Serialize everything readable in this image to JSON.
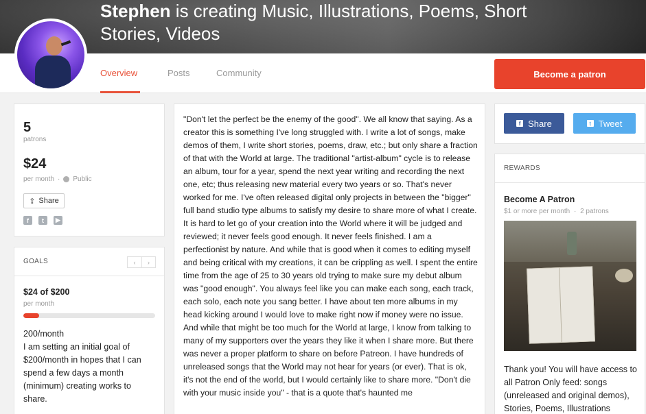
{
  "banner": {
    "creator_name": "Stephen",
    "creating_text": " is creating Music, Illustrations, Poems, Short Stories, Videos"
  },
  "nav": {
    "tabs": [
      {
        "label": "Overview",
        "active": true
      },
      {
        "label": "Posts",
        "active": false
      },
      {
        "label": "Community",
        "active": false
      }
    ],
    "become_patron_label": "Become a patron"
  },
  "stats": {
    "patrons_count": "5",
    "patrons_label": "patrons",
    "amount": "$24",
    "amount_period": "per month",
    "separator": "·",
    "visibility": "Public",
    "share_label": "Share",
    "social_icons": [
      "facebook-icon",
      "twitter-icon",
      "youtube-icon"
    ]
  },
  "goals": {
    "title": "GOALS",
    "prev_symbol": "‹",
    "next_symbol": "›",
    "progress_text": "$24 of $200",
    "progress_period": "per month",
    "progress_fraction": 0.12,
    "goal_amount": "200/month",
    "goal_description": "I am setting an initial goal of $200/month in hopes that I can spend a few days a month (minimum) creating works to share."
  },
  "description": "\"Don't let the perfect be the enemy of the good\".  We all know that saying.  As a creator this is something I've long struggled with.  I write a lot of songs, make demos of them, I write short stories, poems, draw, etc.; but only share a fraction of that with the World at large.  The traditional \"artist-album\" cycle is to release an album, tour for a year, spend the next year writing and recording the next one, etc; thus releasing new material every two years or so.  That's never worked for me.  I've often released digital only projects in between the \"bigger\" full band studio type albums to satisfy my desire to share more of what I create.  It is hard to let go of your creation into the World where it will be judged and reviewed; it never feels good enough.  It never feels finished.  I am a perfectionist by nature.  And while that is good when it comes to editing myself and being critical with my creations, it can be crippling as well.  I spent the entire time from the age of 25 to 30 years old trying to make sure my debut album was \"good enough\".  You always feel like you can make each song, each track, each solo, each note you sang better.  I have about ten more albums in my head kicking around I would love to make right now if money were no issue.  And while that might be too much for the World at large, I know from talking to many of my supporters over the years they like it when I share more.  But there was never a proper platform to share on before Patreon.  I have hundreds of unreleased songs that the World may not hear for years (or ever).  That is ok, it's not the end of the world, but I would certainly like to share more.  \"Don't die with your music inside you\" - that is a quote that's haunted me",
  "share_buttons": {
    "facebook_label": "Share",
    "twitter_label": "Tweet"
  },
  "rewards": {
    "title": "REWARDS",
    "tier_name": "Become A Patron",
    "tier_price": "$1 or more per month",
    "tier_separator": "·",
    "tier_patrons": "2 patrons",
    "tier_description": "Thank you!  You will have access to all Patron Only feed: songs (unreleased and original demos), Stories, Poems, Illustrations"
  },
  "colors": {
    "accent": "#e8432c",
    "facebook": "#3b5a99",
    "twitter": "#55acee"
  }
}
